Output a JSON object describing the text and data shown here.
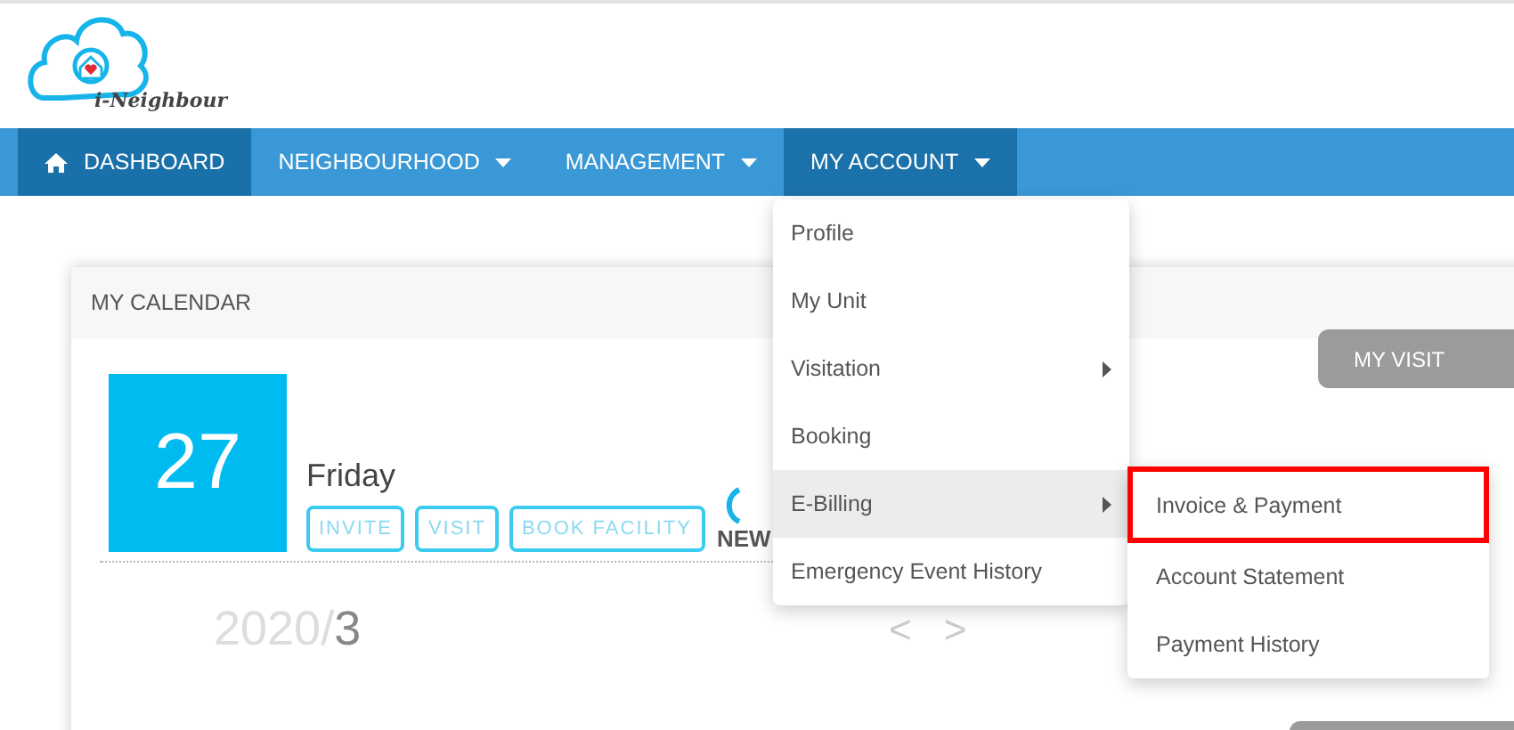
{
  "logo": {
    "text": "i-Neighbour"
  },
  "nav": [
    {
      "label": "DASHBOARD",
      "dropdown": false,
      "selected": true,
      "open": false
    },
    {
      "label": "NEIGHBOURHOOD",
      "dropdown": true,
      "selected": false,
      "open": false
    },
    {
      "label": "MANAGEMENT",
      "dropdown": true,
      "selected": false,
      "open": false
    },
    {
      "label": "MY ACCOUNT",
      "dropdown": true,
      "selected": false,
      "open": true
    }
  ],
  "account_menu": [
    {
      "label": "Profile",
      "submenu": false,
      "highlighted": false
    },
    {
      "label": "My Unit",
      "submenu": false,
      "highlighted": false
    },
    {
      "label": "Visitation",
      "submenu": true,
      "highlighted": false
    },
    {
      "label": "Booking",
      "submenu": false,
      "highlighted": false
    },
    {
      "label": "E-Billing",
      "submenu": true,
      "highlighted": true
    },
    {
      "label": "Emergency Event History",
      "submenu": false,
      "highlighted": false
    }
  ],
  "billing_menu": [
    {
      "label": "Invoice & Payment",
      "outlined": true
    },
    {
      "label": "Account Statement",
      "outlined": false
    },
    {
      "label": "Payment History",
      "outlined": false
    }
  ],
  "calendar": {
    "title": "MY CALENDAR",
    "day": "27",
    "weekday": "Friday",
    "actions": [
      "INVITE",
      "VISIT",
      "BOOK FACILITY"
    ],
    "new_label": "NEW",
    "year": "2020/",
    "month": "3",
    "prev": "<",
    "next": ">",
    "my_visit": "MY VISIT"
  }
}
